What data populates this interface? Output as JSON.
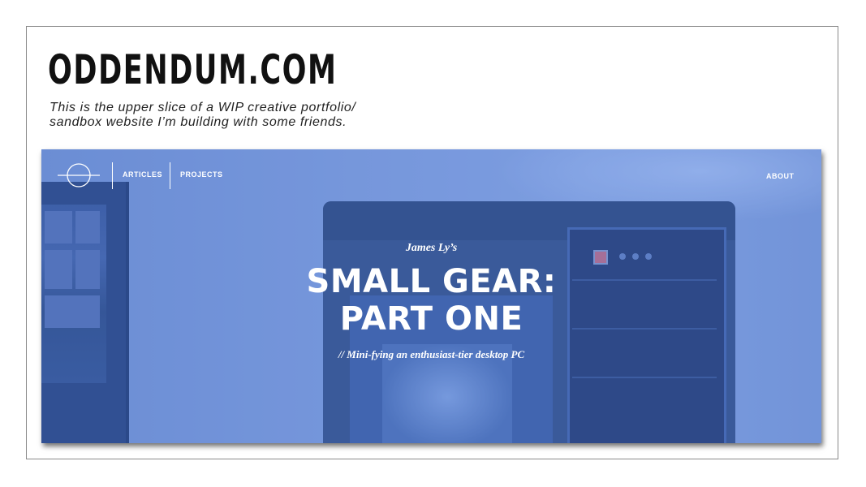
{
  "site": {
    "title": "ODDENDUM.COM",
    "caption_line1": "This is the upper slice of a WIP creative portfolio/",
    "caption_line2": "sandbox website I’m building with some friends."
  },
  "nav": {
    "logo_icon": "circle-crosshair-logo",
    "articles": "ARTICLES",
    "projects": "PROJECTS",
    "about": "ABOUT"
  },
  "hero": {
    "byline": "James Ly’s",
    "headline_line1": "SMALL GEAR:",
    "headline_line2": "PART ONE",
    "subline": "// Mini-fying an enthusiast-tier desktop PC",
    "tint_color": "#6d8fd6"
  }
}
